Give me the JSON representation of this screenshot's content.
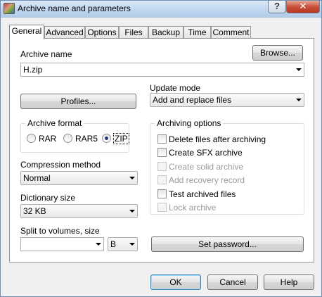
{
  "window": {
    "title": "Archive name and parameters",
    "help_glyph": "?",
    "close_glyph": "✕"
  },
  "tabs": [
    {
      "label": "General"
    },
    {
      "label": "Advanced"
    },
    {
      "label": "Options"
    },
    {
      "label": "Files"
    },
    {
      "label": "Backup"
    },
    {
      "label": "Time"
    },
    {
      "label": "Comment"
    }
  ],
  "archive_name": {
    "label": "Archive name",
    "value": "H.zip",
    "browse_label": "Browse..."
  },
  "update_mode": {
    "label": "Update mode",
    "value": "Add and replace files"
  },
  "profiles_label": "Profiles...",
  "archive_format": {
    "label": "Archive format",
    "options": [
      {
        "label": "RAR"
      },
      {
        "label": "RAR5"
      },
      {
        "label": "ZIP"
      }
    ],
    "selected": "ZIP"
  },
  "archiving_options": {
    "label": "Archiving options",
    "items": [
      {
        "label": "Delete files after archiving",
        "enabled": true
      },
      {
        "label": "Create SFX archive",
        "enabled": true
      },
      {
        "label": "Create solid archive",
        "enabled": false
      },
      {
        "label": "Add recovery record",
        "enabled": false
      },
      {
        "label": "Test archived files",
        "enabled": true
      },
      {
        "label": "Lock archive",
        "enabled": false
      }
    ]
  },
  "compression": {
    "label": "Compression method",
    "value": "Normal"
  },
  "dictionary": {
    "label": "Dictionary size",
    "value": "32 KB"
  },
  "split": {
    "label": "Split to volumes, size",
    "value": "",
    "unit": "B"
  },
  "set_password_label": "Set password...",
  "footer": {
    "ok_label": "OK",
    "cancel_label": "Cancel",
    "help_label": "Help"
  }
}
